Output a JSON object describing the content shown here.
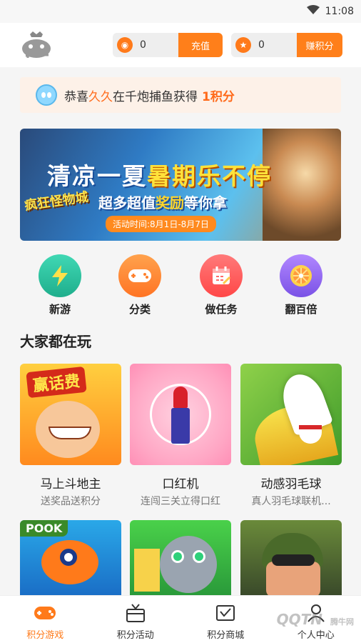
{
  "status": {
    "time": "11:08"
  },
  "header": {
    "coins": {
      "value": "0",
      "button": "充值"
    },
    "points": {
      "value": "0",
      "button": "赚积分"
    }
  },
  "notice": {
    "prefix": "恭喜",
    "user": "久久",
    "middle": "在千炮捕鱼获得",
    "reward": "1积分"
  },
  "banner": {
    "title_a": "清凉一夏",
    "title_b": "暑期乐不停",
    "sub_a": "超多超值",
    "sub_b": "奖励",
    "sub_c": "等你拿",
    "date": "活动时间:8月1日-8月7日",
    "side": "疯狂怪物城"
  },
  "quick": [
    {
      "label": "新游",
      "icon": "lightning-icon",
      "color": "#2ec4a0"
    },
    {
      "label": "分类",
      "icon": "gamepad-icon",
      "color": "#ff8a3d"
    },
    {
      "label": "做任务",
      "icon": "calendar-icon",
      "color": "#ff5a5a"
    },
    {
      "label": "翻百倍",
      "icon": "wheel-icon",
      "color": "#9a6cf0"
    }
  ],
  "section_title": "大家都在玩",
  "games": [
    {
      "name": "马上斗地主",
      "desc": "送奖品送积分",
      "badge": "赢话费"
    },
    {
      "name": "口红机",
      "desc": "连闯三关立得口红",
      "badge": ""
    },
    {
      "name": "动感羽毛球",
      "desc": "真人羽毛球联机...",
      "badge": ""
    },
    {
      "name": "",
      "desc": "",
      "badge": "POOK"
    },
    {
      "name": "",
      "desc": "",
      "badge": ""
    },
    {
      "name": "",
      "desc": "",
      "badge": ""
    }
  ],
  "tabs": [
    {
      "label": "积分游戏",
      "icon": "gamepad-icon",
      "active": true
    },
    {
      "label": "积分活动",
      "icon": "gift-box-icon",
      "active": false
    },
    {
      "label": "积分商城",
      "icon": "shop-icon",
      "active": false
    },
    {
      "label": "个人中心",
      "icon": "user-icon",
      "active": false
    }
  ],
  "watermark": "QQTN",
  "watermark2": "腾牛网"
}
